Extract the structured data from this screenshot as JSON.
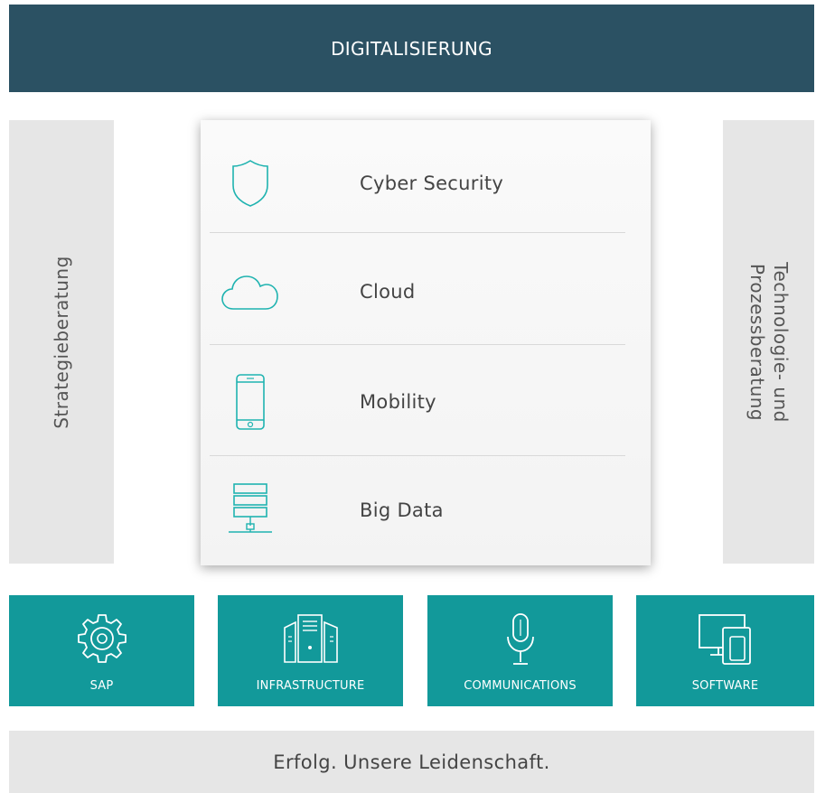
{
  "header": {
    "title": "DIGITALISIERUNG"
  },
  "left_pillar": {
    "label": "Strategieberatung"
  },
  "right_pillar": {
    "label": "Technologie- und\nProzessberatung"
  },
  "center": {
    "items": [
      {
        "label": "Cyber Security",
        "icon": "shield-icon"
      },
      {
        "label": "Cloud",
        "icon": "cloud-icon"
      },
      {
        "label": "Mobility",
        "icon": "smartphone-icon"
      },
      {
        "label": "Big Data",
        "icon": "server-stack-icon"
      }
    ]
  },
  "tiles": [
    {
      "label": "SAP",
      "icon": "gear-icon"
    },
    {
      "label": "INFRASTRUCTURE",
      "icon": "server-towers-icon"
    },
    {
      "label": "COMMUNICATIONS",
      "icon": "microphone-icon"
    },
    {
      "label": "SOFTWARE",
      "icon": "devices-icon"
    }
  ],
  "footer": {
    "tagline": "Erfolg. Unsere Leidenschaft."
  },
  "colors": {
    "header_bg": "#2b5163",
    "tile_bg": "#12999a",
    "icon_teal": "#1fb3b0",
    "panel_gray": "#e6e6e6"
  }
}
